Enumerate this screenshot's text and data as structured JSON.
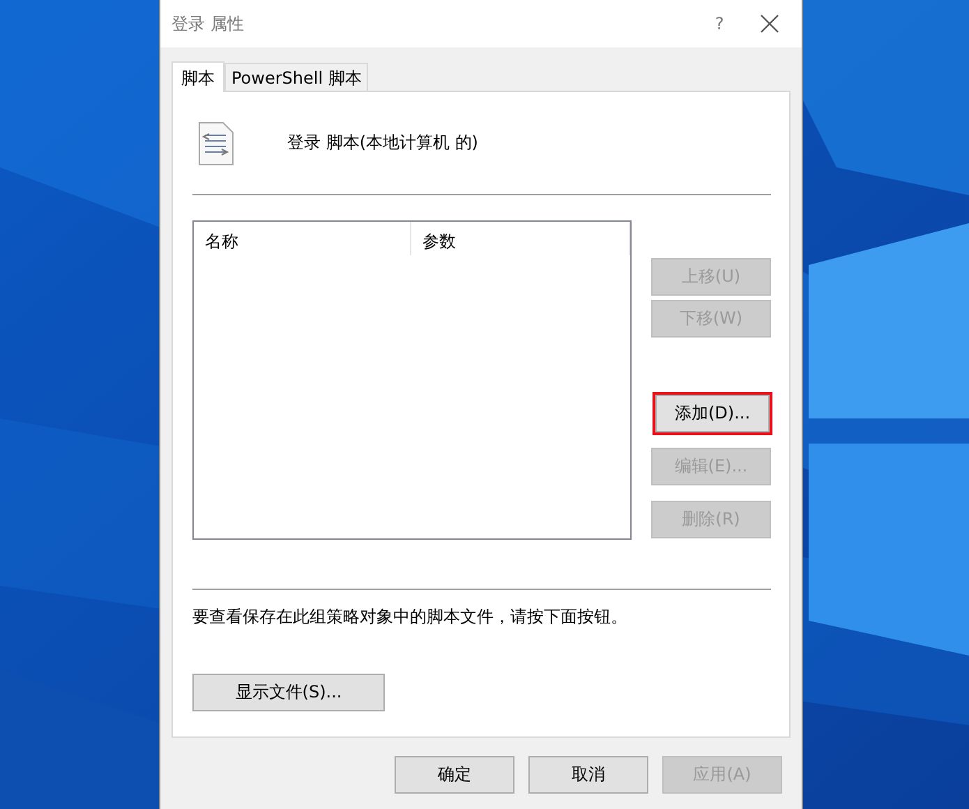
{
  "window": {
    "title": "登录 属性",
    "help": "?"
  },
  "tabs": [
    {
      "label": "脚本",
      "selected": true
    },
    {
      "label": "PowerShell 脚本",
      "selected": false
    }
  ],
  "heading": "登录 脚本(本地计算机 的)",
  "table": {
    "columns": [
      "名称",
      "参数"
    ]
  },
  "side_buttons": [
    {
      "label": "上移(U)",
      "disabled": true,
      "highlighted": false
    },
    {
      "label": "下移(W)",
      "disabled": true,
      "highlighted": false
    },
    {
      "label": "添加(D)...",
      "disabled": false,
      "highlighted": true
    },
    {
      "label": "编辑(E)...",
      "disabled": true,
      "highlighted": false
    },
    {
      "label": "删除(R)",
      "disabled": true,
      "highlighted": false
    }
  ],
  "note": "要查看保存在此组策略对象中的脚本文件，请按下面按钮。",
  "show_files_button": {
    "label": "显示文件(S)...",
    "disabled": false
  },
  "footer_buttons": [
    {
      "label": "确定",
      "disabled": false
    },
    {
      "label": "取消",
      "disabled": false
    },
    {
      "label": "应用(A)",
      "disabled": true
    }
  ]
}
